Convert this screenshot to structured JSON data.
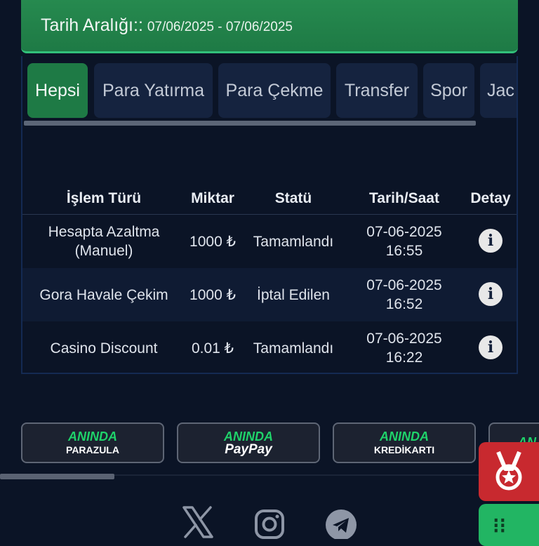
{
  "header": {
    "date_label": "Tarih Aralığı::",
    "date_range": "07/06/2025 - 07/06/2025"
  },
  "tabs": [
    {
      "label": "Hepsi",
      "active": true
    },
    {
      "label": "Para Yatırma",
      "active": false
    },
    {
      "label": "Para Çekme",
      "active": false
    },
    {
      "label": "Transfer",
      "active": false
    },
    {
      "label": "Spor",
      "active": false
    },
    {
      "label": "Jac",
      "active": false
    }
  ],
  "table": {
    "columns": [
      "İşlem Türü",
      "Miktar",
      "Statü",
      "Tarih/Saat",
      "Detay"
    ],
    "rows": [
      {
        "type": "Hesapta Azaltma (Manuel)",
        "amount": "1000 ₺",
        "status": "Tamamlandı",
        "datetime": "07-06-2025 16:55"
      },
      {
        "type": "Gora Havale Çekim",
        "amount": "1000 ₺",
        "status": "İptal Edilen",
        "datetime": "07-06-2025 16:52"
      },
      {
        "type": "Casino Discount",
        "amount": "0.01 ₺",
        "status": "Tamamlandı",
        "datetime": "07-06-2025 16:22"
      }
    ]
  },
  "banners": [
    {
      "top": "ANINDA",
      "bottom": "PARAZULA"
    },
    {
      "top": "ANINDA",
      "bottom": "PayPay"
    },
    {
      "top": "ANINDA",
      "bottom": "KREDİKARTI"
    },
    {
      "top": "AN",
      "bottom": ""
    }
  ],
  "socials": [
    "x-icon",
    "instagram-icon",
    "telegram-icon"
  ],
  "colors": {
    "background": "#0b1426",
    "accent_green": "#1e7a45",
    "tab_bg": "#15233f",
    "fab_red": "#c8292f",
    "fab_green": "#22b563"
  }
}
